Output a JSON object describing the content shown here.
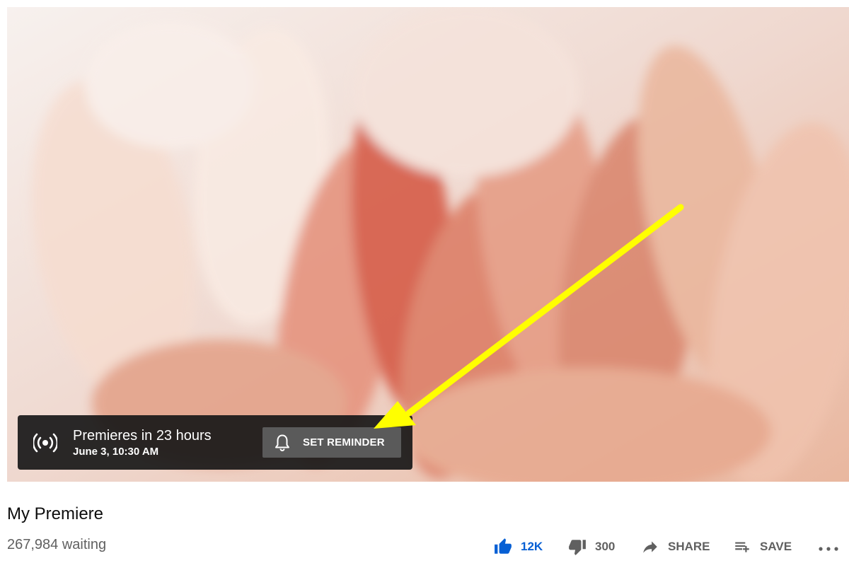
{
  "premiere": {
    "title": "Premieres in 23 hours",
    "date": "June 3, 10:30 AM",
    "reminder_label": "SET REMINDER",
    "live_icon": "live-broadcast-icon",
    "bell_icon": "bell-icon"
  },
  "video": {
    "title": "My Premiere",
    "waiting": "267,984 waiting"
  },
  "actions": {
    "like": {
      "count": "12K",
      "icon": "thumbs-up-icon"
    },
    "dislike": {
      "count": "300",
      "icon": "thumbs-down-icon"
    },
    "share": {
      "label": "SHARE",
      "icon": "share-arrow-icon"
    },
    "save": {
      "label": "SAVE",
      "icon": "playlist-add-icon"
    },
    "more": {
      "icon": "more-horizontal-icon"
    }
  },
  "annotation": {
    "color": "#ffff00",
    "points_to": "SET REMINDER"
  },
  "colors": {
    "like_accent": "#065fd4",
    "overlay": "#181818",
    "button": "#5a5a5a",
    "secondary_text": "#606060"
  }
}
